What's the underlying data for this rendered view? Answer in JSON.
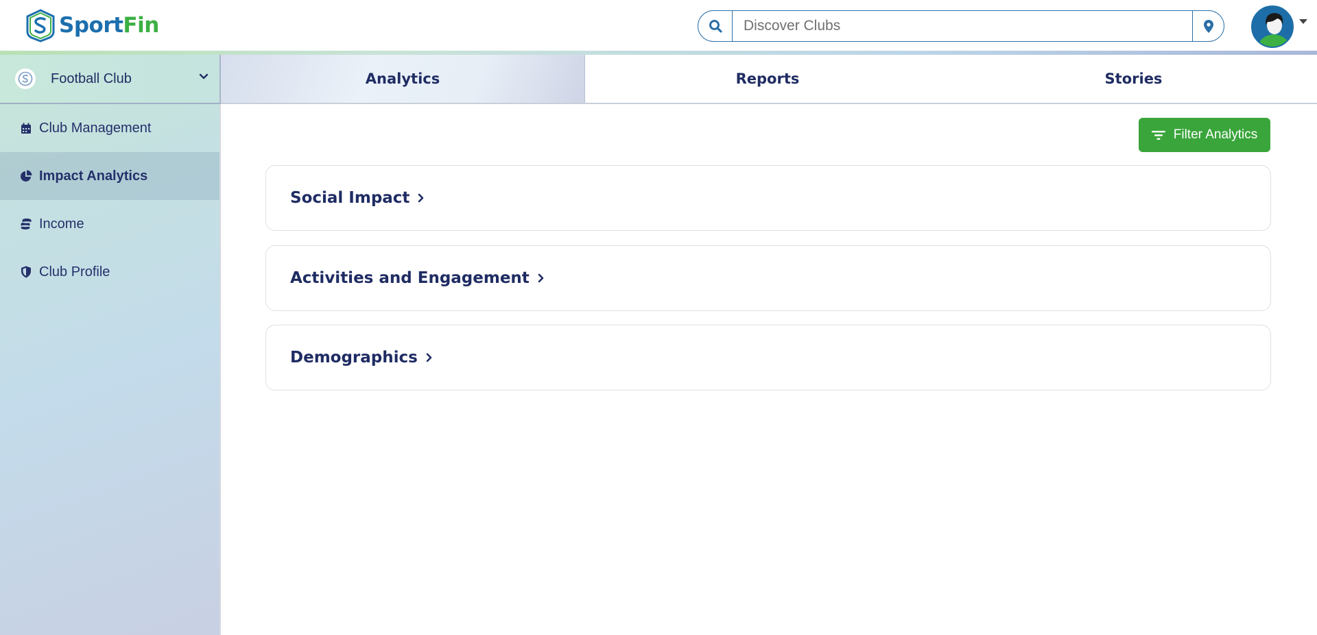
{
  "brand": {
    "name_part1": "Sport",
    "name_part2": "Fin",
    "color_primary": "#1c6fae",
    "color_accent": "#3cb043"
  },
  "search": {
    "placeholder": "Discover Clubs",
    "icon": "search-icon",
    "location_icon": "map-pin-icon"
  },
  "user": {
    "avatar_icon": "user-avatar"
  },
  "sidebar": {
    "club_selector": {
      "label": "Football Club",
      "icon": "club-logo-icon"
    },
    "items": [
      {
        "label": "Club Management",
        "icon": "calendar-icon",
        "active": false
      },
      {
        "label": "Impact Analytics",
        "icon": "pie-chart-icon",
        "active": true
      },
      {
        "label": "Income",
        "icon": "coins-icon",
        "active": false
      },
      {
        "label": "Club Profile",
        "icon": "shield-icon",
        "active": false
      }
    ]
  },
  "tabs": [
    {
      "label": "Analytics",
      "active": true
    },
    {
      "label": "Reports",
      "active": false
    },
    {
      "label": "Stories",
      "active": false
    }
  ],
  "main": {
    "filter_button": {
      "label": "Filter Analytics",
      "color": "#3aa53b"
    },
    "sections": [
      {
        "title": "Social Impact"
      },
      {
        "title": "Activities and Engagement"
      },
      {
        "title": "Demographics"
      }
    ]
  }
}
